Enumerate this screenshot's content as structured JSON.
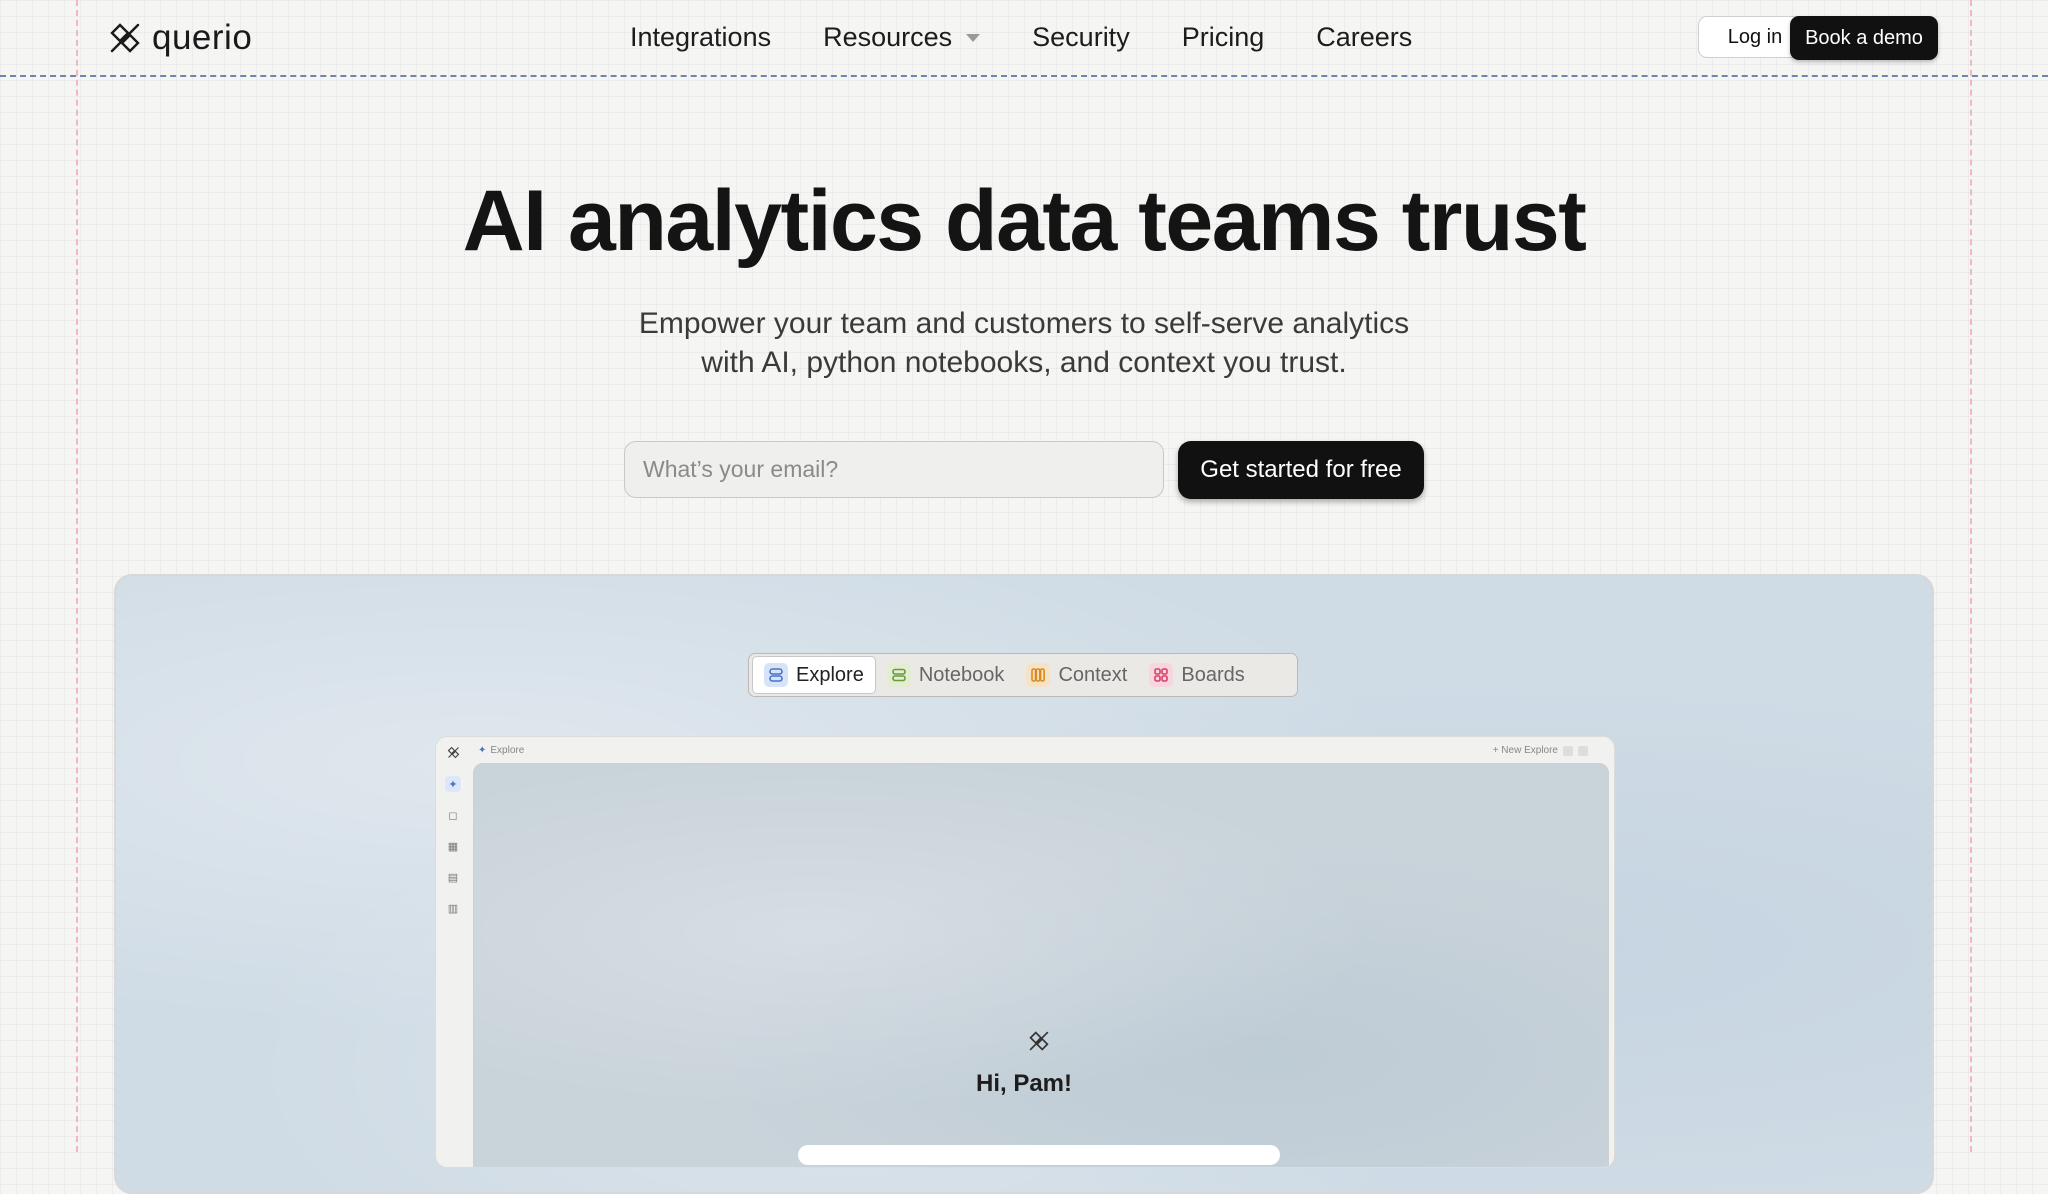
{
  "brand": {
    "name": "querio"
  },
  "nav": {
    "items": [
      {
        "label": "Integrations",
        "dropdown": false
      },
      {
        "label": "Resources",
        "dropdown": true
      },
      {
        "label": "Security",
        "dropdown": false
      },
      {
        "label": "Pricing",
        "dropdown": false
      },
      {
        "label": "Careers",
        "dropdown": false
      }
    ],
    "login_label": "Log in",
    "demo_label": "Book a demo"
  },
  "hero": {
    "title": "AI analytics data teams trust",
    "subtitle_line1": "Empower your team and customers to self-serve analytics",
    "subtitle_line2": "with AI, python notebooks, and context you trust.",
    "email_placeholder": "What’s your email?",
    "cta_label": "Get started for free"
  },
  "showcase": {
    "tabs": [
      {
        "label": "Explore",
        "icon": "explore-icon",
        "color": "#4a74c8",
        "active": true
      },
      {
        "label": "Notebook",
        "icon": "notebook-icon",
        "color": "#6a9a3c",
        "active": false
      },
      {
        "label": "Context",
        "icon": "context-icon",
        "color": "#d98a1f",
        "active": false
      },
      {
        "label": "Boards",
        "icon": "boards-icon",
        "color": "#d6416b",
        "active": false
      }
    ],
    "app": {
      "breadcrumb": "Explore",
      "new_explore_label": "+ New Explore",
      "greeting": "Hi, Pam!"
    }
  },
  "colors": {
    "accent_dark": "#111111",
    "background": "#f5f5f4",
    "guide_pink": "#f0b8c0",
    "guide_blue": "#6d86ad"
  }
}
